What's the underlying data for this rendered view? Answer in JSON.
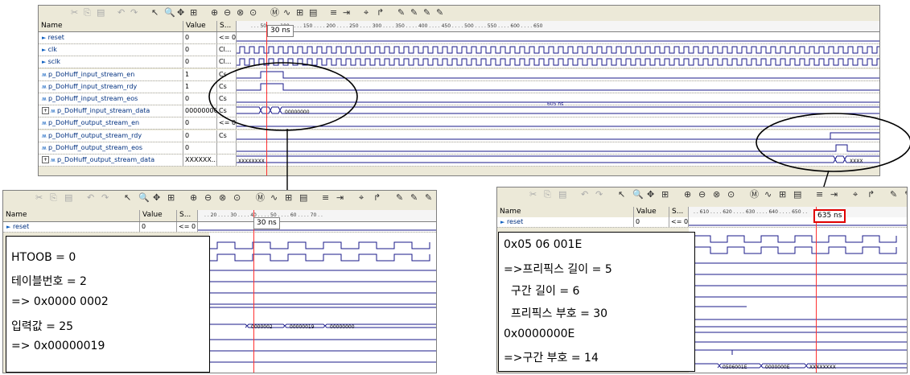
{
  "toolbar": {
    "icons": [
      "cut-icon",
      "copy-icon",
      "paste-icon",
      "undo-icon",
      "redo-icon",
      "select-arrow-icon",
      "zoom-icon",
      "move-icon",
      "region-zoom-icon",
      "zoom-in-icon",
      "zoom-out-icon",
      "zoom-fit-icon",
      "zoom-full-icon",
      "bus-icon",
      "wave-icon",
      "find-icon",
      "marker-icon",
      "grid-icon",
      "step-icon",
      "binoculars-icon",
      "search-next-icon",
      "pen-icon",
      "pen2-icon",
      "pen3-icon",
      "pen4-icon"
    ],
    "glyphs": [
      "✂",
      "⎘",
      "▤",
      "↶",
      "↷",
      "↖",
      "🔍",
      "✥",
      "⊞",
      "⊕",
      "⊖",
      "⊗",
      "⊙",
      "Ⓜ",
      "∿",
      "⊞",
      "▤",
      "≡",
      "⇥",
      "⌖",
      "↱",
      "✎",
      "✎",
      "✎",
      "✎"
    ]
  },
  "headers": {
    "name": "Name",
    "value": "Value",
    "s": "S..."
  },
  "main": {
    "ruler": [
      ". . . 50 . . . . 100 . . . . 150 . . . . 200 . . . . 250 . . . . 300 . . . . 350 . . . . 400 . . . . 450 . . . . 500 . . . . 550 . . . . 600 . . . . 650"
    ],
    "marker_label": "30 ns",
    "span_label": "605 ns",
    "signals": [
      {
        "name": "reset",
        "value": "0",
        "s": "<= 0"
      },
      {
        "name": "clk",
        "value": "0",
        "s": "Cl..."
      },
      {
        "name": "sclk",
        "value": "0",
        "s": "Cl..."
      },
      {
        "name": "p_DoHuff_input_stream_en",
        "value": "1",
        "s": "Cs"
      },
      {
        "name": "p_DoHuff_input_stream_rdy",
        "value": "1",
        "s": "Cs"
      },
      {
        "name": "p_DoHuff_input_stream_eos",
        "value": "0",
        "s": "Cs"
      },
      {
        "name": "p_DoHuff_input_stream_data",
        "value": "00000000",
        "s": "Cs"
      },
      {
        "name": "p_DoHuff_output_stream_en",
        "value": "0",
        "s": "<= 0"
      },
      {
        "name": "p_DoHuff_output_stream_rdy",
        "value": "0",
        "s": "Cs"
      },
      {
        "name": "p_DoHuff_output_stream_eos",
        "value": "0",
        "s": ""
      },
      {
        "name": "p_DoHuff_output_stream_data",
        "value": "XXXXXX...",
        "s": ""
      }
    ],
    "bus_value": "00000000",
    "out_bus_value": "XXXXXXXX",
    "out_bus_end": "XXXX"
  },
  "left": {
    "ruler": ". . 20 . . . . 30 . . . . 40 . . . . 50 . . . . 60 . . . . 70 . .",
    "marker_label": "30 ns",
    "signal": {
      "name": "reset",
      "value": "0",
      "s": "<= 0"
    },
    "bus": [
      "0000002",
      "00000019",
      "00000000"
    ],
    "note": [
      "HTOOB = 0",
      "테이블번호 = 2",
      "=> 0x0000 0002",
      "입력값 = 25",
      "=> 0x00000019"
    ]
  },
  "right": {
    "ruler": ". . 610 . . . . 620 . . . . 630 . . . . 640 . . . . 650 . .",
    "marker_label": "635 ns",
    "signal": {
      "name": "reset",
      "value": "0",
      "s": "<= 0"
    },
    "bus": [
      "0506001E",
      "0000000E",
      "XXXXXXXX"
    ],
    "note": [
      "0x05 06 001E",
      "=>프리픽스 길이 = 5",
      "  구간 길이 = 6",
      "  프리픽스 부호 = 30",
      "0x0000000E",
      "=>구간 부호 = 14"
    ]
  }
}
